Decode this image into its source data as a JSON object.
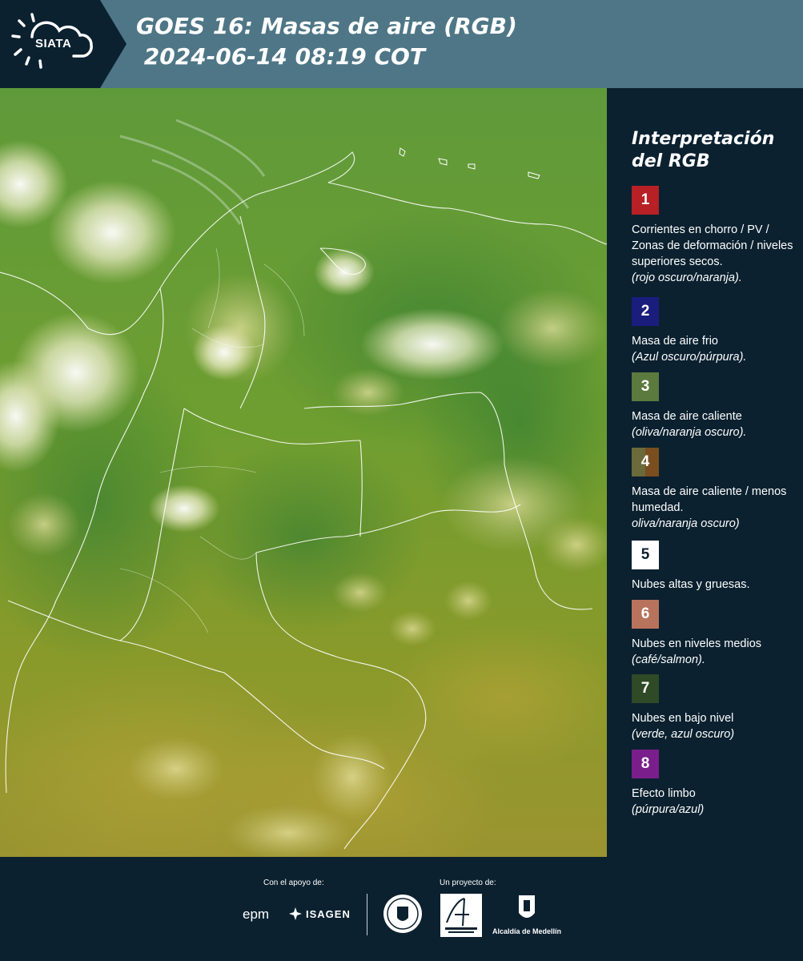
{
  "header": {
    "logo_text": "SIATA",
    "title": "GOES 16: Masas de aire (RGB)\n 2024-06-14 08:19 COT"
  },
  "panel": {
    "title": "Interpretación del RGB",
    "legend": [
      {
        "num": "1",
        "color": "#b72025",
        "desc": "Corrientes en chorro / PV / Zonas de deformación / niveles superiores secos.",
        "note": "(rojo oscuro/naranja)."
      },
      {
        "num": "2",
        "color": "#1b1d7d",
        "desc": "Masa de aire frio",
        "note": "(Azul oscuro/púrpura)."
      },
      {
        "num": "3",
        "color": "#5b7a3d",
        "desc": "Masa de aire caliente",
        "note": "(oliva/naranja oscuro)."
      },
      {
        "num": "4",
        "color": "#7a5a28",
        "desc": "Masa de aire caliente / menos humedad.",
        "note": "oliva/naranja oscuro)"
      },
      {
        "num": "5",
        "color": "#ffffff",
        "desc": "Nubes altas y gruesas.",
        "note": ""
      },
      {
        "num": "6",
        "color": "#b8735c",
        "desc": "Nubes en niveles medios",
        "note": "(café/salmon)."
      },
      {
        "num": "7",
        "color": "#2f4a26",
        "desc": "Nubes en bajo nivel",
        "note": "(verde, azul oscuro)"
      },
      {
        "num": "8",
        "color": "#7a1e8c",
        "desc": "Efecto limbo",
        "note": "(púrpura/azul)"
      }
    ]
  },
  "footer": {
    "support_label": "Con el apoyo de:",
    "project_label": "Un proyecto de:",
    "epm": "epm",
    "isagen": "ISAGEN",
    "alcaldia": "Alcaldía de Medellín"
  }
}
